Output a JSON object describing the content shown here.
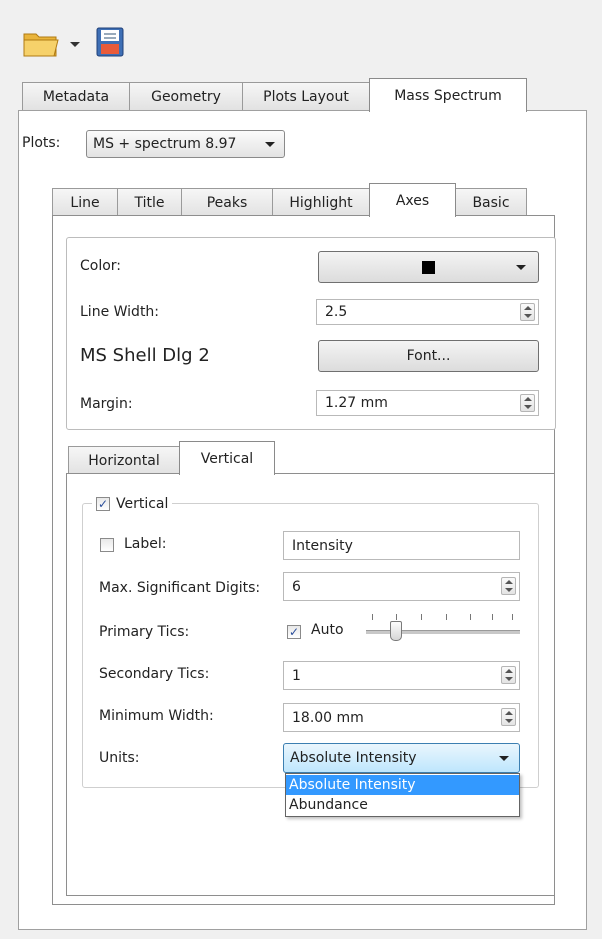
{
  "toolbar": {
    "open_icon": "folder-icon",
    "save_icon": "floppy-disk-icon"
  },
  "main_tabs": [
    {
      "label": "Metadata"
    },
    {
      "label": "Geometry"
    },
    {
      "label": "Plots Layout"
    },
    {
      "label": "Mass Spectrum",
      "active": true
    }
  ],
  "plots": {
    "label": "Plots:",
    "value": "MS + spectrum 8.97"
  },
  "sub_tabs": [
    {
      "label": "Line"
    },
    {
      "label": "Title"
    },
    {
      "label": "Peaks"
    },
    {
      "label": "Highlight"
    },
    {
      "label": "Axes",
      "active": true
    },
    {
      "label": "Basic"
    }
  ],
  "axes": {
    "color_label": "Color:",
    "color_value": "#000000",
    "line_width_label": "Line Width:",
    "line_width_value": "2.5",
    "font_name": "MS Shell Dlg 2",
    "font_button": "Font...",
    "margin_label": "Margin:",
    "margin_value": "1.27 mm"
  },
  "axis_tabs": [
    {
      "label": "Horizontal"
    },
    {
      "label": "Vertical",
      "active": true
    }
  ],
  "vertical": {
    "group_label": "Vertical",
    "group_checked": true,
    "label_label": "Label:",
    "label_checked": false,
    "label_value": "Intensity",
    "max_digits_label": "Max. Significant Digits:",
    "max_digits_value": "6",
    "primary_tics_label": "Primary Tics:",
    "auto_label": "Auto",
    "auto_checked": true,
    "slider_value": 0.25,
    "secondary_tics_label": "Secondary Tics:",
    "secondary_tics_value": "1",
    "min_width_label": "Minimum Width:",
    "min_width_value": "18.00 mm",
    "units_label": "Units:",
    "units_value": "Absolute Intensity",
    "units_options": [
      "Absolute Intensity",
      "Abundance"
    ],
    "units_highlighted": "Absolute Intensity"
  }
}
